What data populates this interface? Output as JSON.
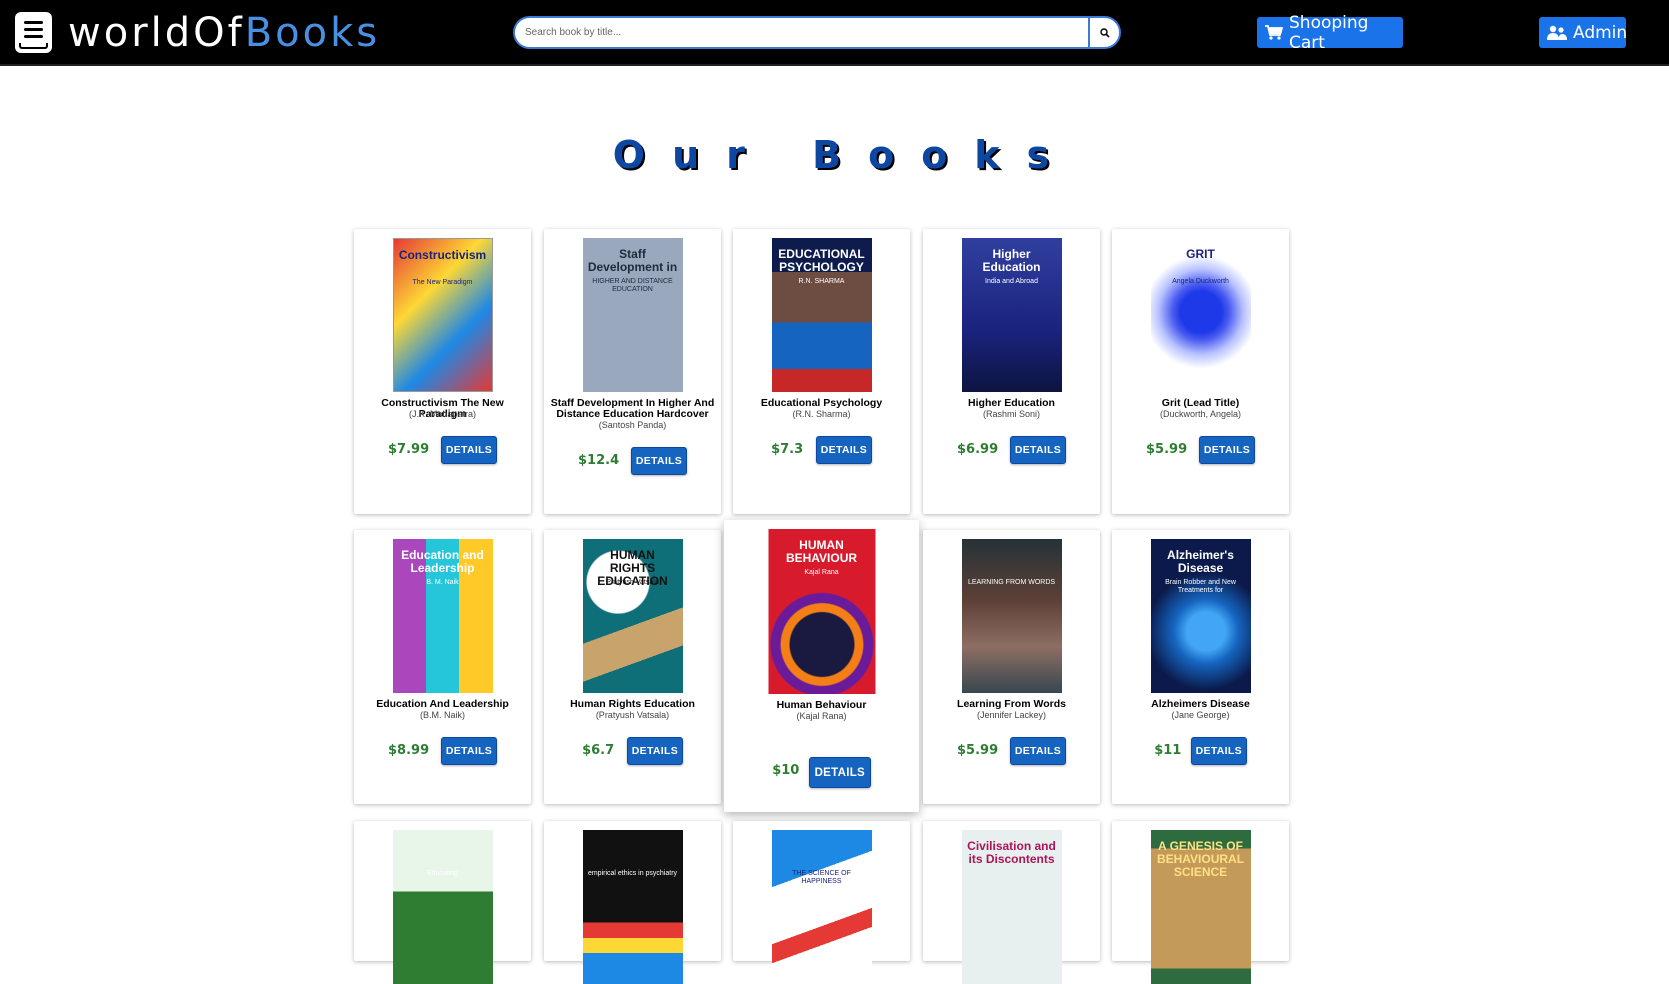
{
  "header": {
    "logo_text_1": "worldOf",
    "logo_text_2": "Books",
    "search_placeholder": "Search book by title...",
    "cart_label": "Shooping Cart",
    "admin_label": "Admin"
  },
  "page_title": "Our Books",
  "details_label": "DETAILS",
  "books": [
    {
      "title": "Constructivism The New Paradigm",
      "author": "(J.K. Mohapatra)",
      "price": "$7.99",
      "cover": {
        "title": "Constructivism",
        "subtitle": "The New Paradigm"
      }
    },
    {
      "title": "Staff Development In Higher And Distance Education Hardcover",
      "author": "(Santosh Panda)",
      "price": "$12.4",
      "cover": {
        "title": "Staff Development in",
        "subtitle": "HIGHER AND DISTANCE EDUCATION"
      }
    },
    {
      "title": "Educational Psychology",
      "author": "(R.N. Sharma)",
      "price": "$7.3",
      "cover": {
        "title": "EDUCATIONAL PSYCHOLOGY",
        "subtitle": "R.N. SHARMA"
      }
    },
    {
      "title": "Higher Education",
      "author": "(Rashmi Soni)",
      "price": "$6.99",
      "cover": {
        "title": "Higher Education",
        "subtitle": "India and Abroad"
      }
    },
    {
      "title": "Grit (Lead Title)",
      "author": "(Duckworth, Angela)",
      "price": "$5.99",
      "cover": {
        "title": "GRIT",
        "subtitle": "Angela Duckworth"
      }
    },
    {
      "title": "Education And Leadership",
      "author": "(B.M. Naik)",
      "price": "$8.99",
      "cover": {
        "title": "Education and Leadership",
        "subtitle": "B. M. Naik"
      }
    },
    {
      "title": "Human Rights Education",
      "author": "(Pratyush Vatsala)",
      "price": "$6.7",
      "cover": {
        "title": "HUMAN RIGHTS EDUCATION",
        "subtitle": "Pratyush Vatsala"
      }
    },
    {
      "title": "Human Behaviour",
      "author": "(Kajal Rana)",
      "price": "$10",
      "cover": {
        "title": "HUMAN BEHAVIOUR",
        "subtitle": "Kajal Rana"
      }
    },
    {
      "title": "Learning From Words",
      "author": "(Jennifer Lackey)",
      "price": "$5.99",
      "cover": {
        "title": "",
        "subtitle": "LEARNING FROM WORDS"
      }
    },
    {
      "title": "Alzheimers Disease",
      "author": "(Jane George)",
      "price": "$11",
      "cover": {
        "title": "Alzheimer's Disease",
        "subtitle": "Brain Robber and New Treatments for"
      }
    },
    {
      "title": "",
      "author": "",
      "price": "",
      "cover": {
        "title": "",
        "subtitle": "Educating"
      }
    },
    {
      "title": "",
      "author": "",
      "price": "",
      "cover": {
        "title": "",
        "subtitle": "empirical ethics in psychiatry"
      }
    },
    {
      "title": "",
      "author": "",
      "price": "",
      "cover": {
        "title": "",
        "subtitle": "THE SCIENCE OF HAPPINESS"
      }
    },
    {
      "title": "",
      "author": "",
      "price": "",
      "cover": {
        "title": "Civilisation and its Discontents",
        "subtitle": ""
      }
    },
    {
      "title": "",
      "author": "",
      "price": "",
      "cover": {
        "title": "A GENESIS OF BEHAVIOURAL SCIENCE",
        "subtitle": ""
      }
    }
  ],
  "colors": {
    "header_bg": "#000000",
    "accent": "#4a90e2",
    "button": "#1565c0",
    "price": "#2e7d32",
    "title": "#0d47a1"
  }
}
